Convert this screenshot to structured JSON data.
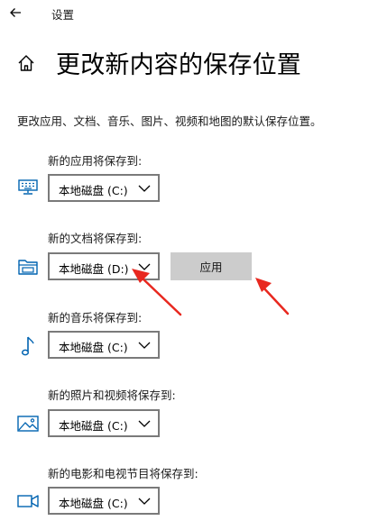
{
  "window": {
    "title": "设置"
  },
  "page": {
    "title": "更改新内容的保存位置",
    "description": "更改应用、文档、音乐、图片、视频和地图的默认保存位置。"
  },
  "rows": [
    {
      "label": "新的应用将保存到:",
      "value": "本地磁盘 (C:)",
      "icon": "monitor-keyboard-icon"
    },
    {
      "label": "新的文档将保存到:",
      "value": "本地磁盘 (D:)",
      "icon": "folder-icon"
    },
    {
      "label": "新的音乐将保存到:",
      "value": "本地磁盘 (C:)",
      "icon": "music-note-icon"
    },
    {
      "label": "新的照片和视频将保存到:",
      "value": "本地磁盘 (C:)",
      "icon": "picture-icon"
    },
    {
      "label": "新的电影和电视节目将保存到:",
      "value": "本地磁盘 (C:)",
      "icon": "video-camera-icon"
    }
  ],
  "apply_button": {
    "label": "应用"
  },
  "colors": {
    "accent": "#0063b1",
    "arrow": "#e8281f",
    "button_bg": "#cccccc"
  }
}
